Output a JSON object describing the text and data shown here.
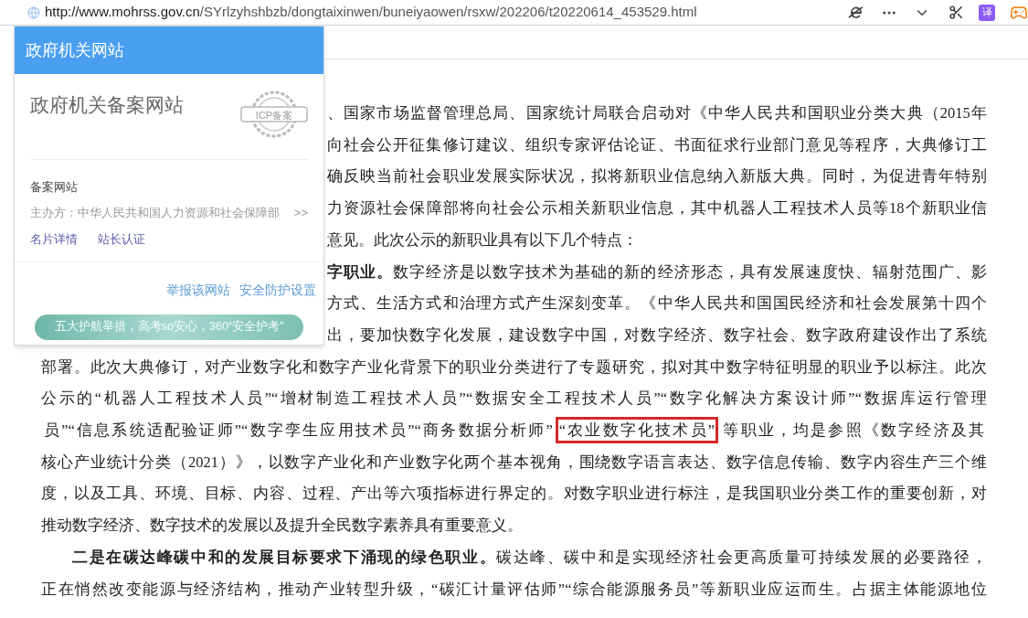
{
  "browser": {
    "url_host": "http://www.mohrss.gov.cn",
    "url_path": "/SYrlzyhshbzb/dongtaixinwen/buneiyaowen/rsxw/202206/t20220614_453529.html",
    "translate_label": "译"
  },
  "popup": {
    "header": "政府机关网站",
    "title": "政府机关备案网站",
    "seal_text": "ICP备案",
    "section_label": "备案网站",
    "sponsor": "主办方：中华人民共和国人力资源和社会保障部",
    "more": ">>",
    "links": [
      "名片详情",
      "站长认证"
    ],
    "actions": [
      "举报该网站",
      "安全防护设置"
    ],
    "banner": "五大护航举措，高考so安心，360“安全护考”"
  },
  "article": {
    "partial_lines": [
      "、国家市场监督管理总局、国家统计局联合启动对《中华人民共和国职业分类大典（2015年",
      "向社会公开征集修订建议、组织专家评估论证、书面征求行业部门意见等程序，大典修订工",
      "确反映当前社会职业发展实际状况，拟将新职业信息纳入新版大典。同时，为促进青年特别",
      "力资源社会保障部将向社会公示相关新职业信息，其中机器人工程技术人员等18个新职业信",
      "意见。此次公示的新职业具有以下几个特点：",
      "**字职业。**数字经济是以数字技术为基础的新的经济形态，具有发展速度快、辐射范围广、影",
      "方式、生活方式和治理方式产生深刻变革。《中华人民共和国国民经济和社会发展第十四个",
      "出，要加快数字化发展，建设数字中国，对数字经济、数字社会、数字政府建设作出了系统"
    ],
    "lines": [
      {
        "indent": false,
        "last": false,
        "text": "部署。此次大典修订，对产业数字化和数字产业化背景下的职业分类进行了专题研究，拟对其中数字特征明显的职业予以标注。此次"
      },
      {
        "indent": false,
        "last": false,
        "text": "公示的“机器人工程技术人员”“增材制造工程技术人员”“数据安全工程技术人员”“数字化解决方案设计师”“数据库运行管理"
      },
      {
        "indent": false,
        "last": false,
        "segments": [
          {
            "text": "员”“信息系统适配验证师”“数字孪生应用技术员”“商务数据分析师”",
            "highlighted": false
          },
          {
            "text": "“农业数字化技术员”",
            "highlighted": true
          },
          {
            "text": "等职业，均是参照《数字经济及其",
            "highlighted": false
          }
        ]
      },
      {
        "indent": false,
        "last": false,
        "text": "核心产业统计分类（2021）》，以数字产业化和产业数字化两个基本视角，围绕数字语言表达、数字信息传输、数字内容生产三个维"
      },
      {
        "indent": false,
        "last": false,
        "text": "度，以及工具、环境、目标、内容、过程、产出等六项指标进行界定的。对数字职业进行标注，是我国职业分类工作的重要创新，对"
      },
      {
        "indent": false,
        "last": true,
        "text": "推动数字经济、数字技术的发展以及提升全民数字素养具有重要意义。"
      },
      {
        "indent": true,
        "last": false,
        "text": "**二是在碳达峰碳中和的发展目标要求下涌现的绿色职业。**碳达峰、碳中和是实现经济社会更高质量可持续发展的必要路径，"
      },
      {
        "indent": false,
        "last": false,
        "text": "正在悄然改变能源与经济结构，推动产业转型升级，“碳汇计量评估师”“综合能源服务员”等新职业应运而生。占据主体能源地位"
      }
    ]
  }
}
